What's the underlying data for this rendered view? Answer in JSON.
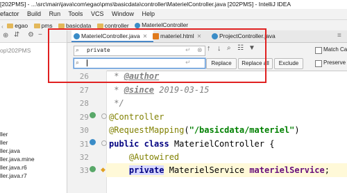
{
  "window": {
    "title": "[202PMS] - ...\\src\\main\\java\\com\\egao\\pms\\basicdata\\controller\\MaterielController.java [202PMS] - IntelliJ IDEA"
  },
  "menu": [
    "efactor",
    "Build",
    "Run",
    "Tools",
    "VCS",
    "Window",
    "Help"
  ],
  "breadcrumbs": [
    "egao",
    "pms",
    "basicdata",
    "controller",
    "MaterielController"
  ],
  "project_panel": {
    "path_text": "op\\202PMS",
    "items": [
      "ller",
      "ller",
      "ller.java",
      "ller.java.mine",
      "ller.java.r6",
      "ller.java.r7"
    ]
  },
  "tabs": [
    {
      "label": "MaterielController.java",
      "active": true,
      "icon": "java-class-icon"
    },
    {
      "label": "materiel.html",
      "active": false,
      "icon": "html-file-icon"
    },
    {
      "label": "ProjectController.java",
      "active": false,
      "icon": "java-class-icon"
    }
  ],
  "find": {
    "search_value": "private",
    "replace_value": "",
    "replace_label": "Replace",
    "replace_all_label": "Replace all",
    "exclude_label": "Exclude",
    "match_case_label": "Match Cas",
    "preserve_case_label": "Preserve C"
  },
  "editor": {
    "lines": [
      {
        "num": "26",
        "text": " * @author"
      },
      {
        "num": "27",
        "text": " * @since 2019-03-15"
      },
      {
        "num": "28",
        "text": " */"
      },
      {
        "num": "29",
        "text": "@Controller"
      },
      {
        "num": "30",
        "text": "@RequestMapping(\"/basicdata/materiel\")"
      },
      {
        "num": "31",
        "text": "public class MaterielController {"
      },
      {
        "num": "32",
        "text": "    @Autowired"
      },
      {
        "num": "33",
        "text": "    private MaterielService materielService;"
      }
    ],
    "comment_tag_author": "@author",
    "comment_tag_since": "@since",
    "since_date": "2019-03-15",
    "annotation_controller": "@Controller",
    "annotation_mapping": "@RequestMapping",
    "mapping_path": "\"/basicdata/materiel\"",
    "kw_public": "public",
    "kw_class": "class",
    "class_name": "MaterielController",
    "annotation_autowired": "@Autowired",
    "kw_private": "private",
    "type_name": "MaterielService",
    "field_name": "materielService"
  },
  "colors": {
    "highlight_box": "#e02020",
    "accent": "#4a88c7"
  }
}
